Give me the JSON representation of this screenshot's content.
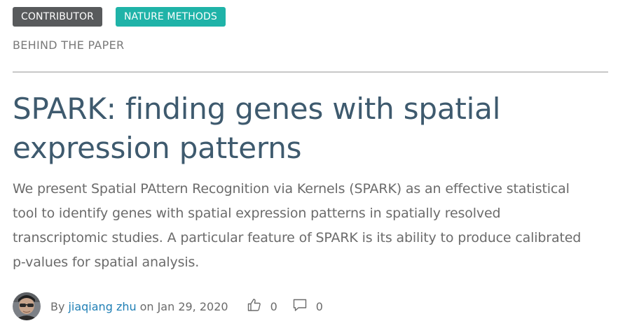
{
  "badges": {
    "contributor": "CONTRIBUTOR",
    "journal": "NATURE METHODS"
  },
  "section_label": "BEHIND THE PAPER",
  "post": {
    "title": "SPARK: finding genes with spatial expression patterns",
    "summary": "We present Spatial PAttern Recognition via Kernels (SPARK) as an effective statistical tool to identify genes with spatial expression patterns in spatially resolved transcriptomic studies. A particular feature of SPARK is its ability to produce calibrated p-values for spatial analysis."
  },
  "meta": {
    "by_label": "By",
    "author": "jiaqiang zhu",
    "on_label": "on",
    "date": "Jan 29, 2020",
    "likes_count": "0",
    "comments_count": "0",
    "likes_icon": "thumbs-up-icon",
    "comments_icon": "comment-icon"
  },
  "colors": {
    "contributor_badge": "#585a5c",
    "journal_badge": "#1fb3a8",
    "title": "#3e5a6e",
    "author_link": "#1f7fb5",
    "body_text": "#6b6b6b"
  }
}
